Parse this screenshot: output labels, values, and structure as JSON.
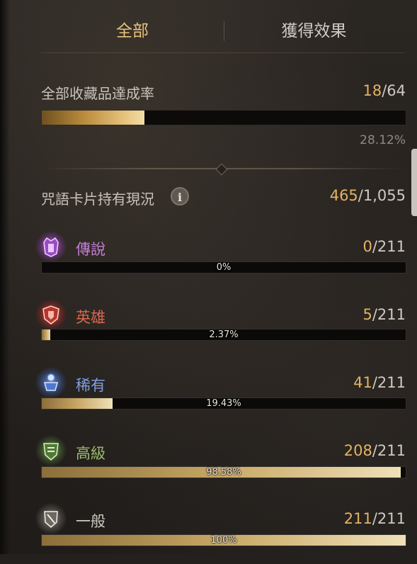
{
  "tabs": [
    {
      "label": "全部",
      "active": true
    },
    {
      "label": "獲得效果",
      "active": false
    }
  ],
  "collection": {
    "label": "全部收藏品達成率",
    "current": "18",
    "total": "/64",
    "percent_text": "28.12%",
    "progress": 0.2812
  },
  "cards": {
    "label": "咒語卡片持有現況",
    "current": "465",
    "total": "/1,055",
    "info_icon": "info-icon"
  },
  "rarities": [
    {
      "name": "傳說",
      "current": "0",
      "total": "/211",
      "percent_text": "0%",
      "progress": 0.0,
      "color": "#c57fd8",
      "icon": "legendary-emblem-icon"
    },
    {
      "name": "英雄",
      "current": "5",
      "total": "/211",
      "percent_text": "2.37%",
      "progress": 0.0237,
      "color": "#d9684e",
      "icon": "heroic-emblem-icon"
    },
    {
      "name": "稀有",
      "current": "41",
      "total": "/211",
      "percent_text": "19.43%",
      "progress": 0.1943,
      "color": "#7f9ee0",
      "icon": "rare-emblem-icon"
    },
    {
      "name": "高級",
      "current": "208",
      "total": "/211",
      "percent_text": "98.58%",
      "progress": 0.9858,
      "color": "#9cbd6e",
      "icon": "advanced-emblem-icon"
    },
    {
      "name": "一般",
      "current": "211",
      "total": "/211",
      "percent_text": "100%",
      "progress": 1.0,
      "color": "#cfcac2",
      "icon": "common-emblem-icon"
    }
  ],
  "colors": {
    "accent_gold": "#e2b363",
    "background": "#23201d"
  }
}
